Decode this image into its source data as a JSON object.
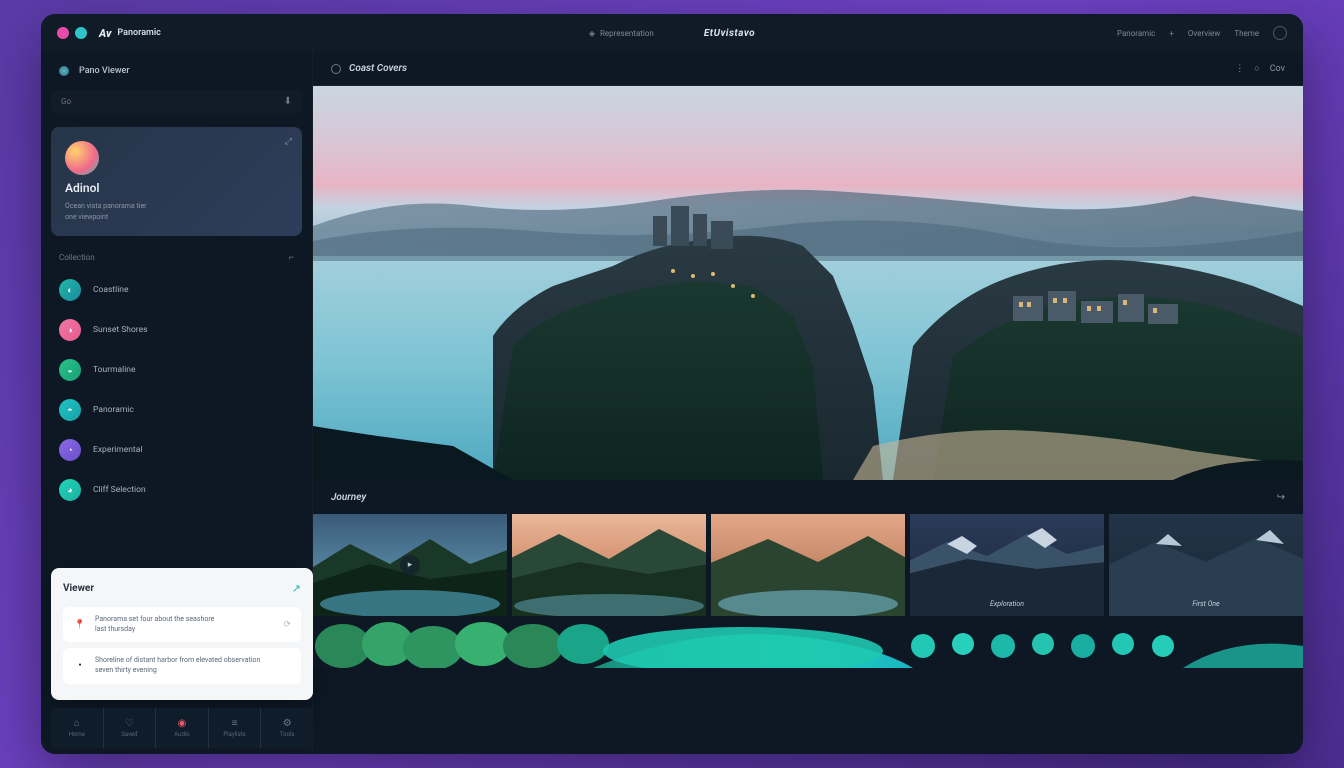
{
  "titlebar": {
    "brand_logo": "Av",
    "brand_text": "Panoramic",
    "tab_label": "Representation",
    "app_name": "EtUvistavo",
    "right_items": [
      "Panoramic",
      "Overview",
      "Theme"
    ]
  },
  "sidebar": {
    "header": "Pano Viewer",
    "search_placeholder": "Go",
    "active_card": {
      "title": "Adinol",
      "subtitle_1": "Ocean vista panorama tier",
      "subtitle_2": "one viewpoint"
    },
    "section_label": "Collection",
    "items": [
      {
        "label": "Coastline"
      },
      {
        "label": "Sunset Shores"
      },
      {
        "label": "Tourmaline"
      },
      {
        "label": "Panoramic"
      },
      {
        "label": "Experimental"
      },
      {
        "label": "Cliff Selection"
      }
    ]
  },
  "popup": {
    "title": "Viewer",
    "items": [
      {
        "text_1": "Panorama set four about the seashore",
        "text_2": "last thursday"
      },
      {
        "text_1": "Shoreline of distant harbor from elevated observation",
        "text_2": "seven thirty evening"
      }
    ]
  },
  "main": {
    "header_title": "Coast Covers",
    "header_badge": "Cov",
    "strip_title": "Journey",
    "thumbs": [
      {
        "caption": ""
      },
      {
        "caption": ""
      },
      {
        "caption": ""
      },
      {
        "caption": "Exploration"
      },
      {
        "caption": "First One"
      }
    ]
  },
  "dock": {
    "items": [
      "Home",
      "Saved",
      "Audio",
      "Playlists",
      "Tools"
    ]
  },
  "colors": {
    "bg_dark": "#0d1824",
    "accent_teal": "#1fc4b4",
    "accent_pink": "#e85a8a"
  }
}
